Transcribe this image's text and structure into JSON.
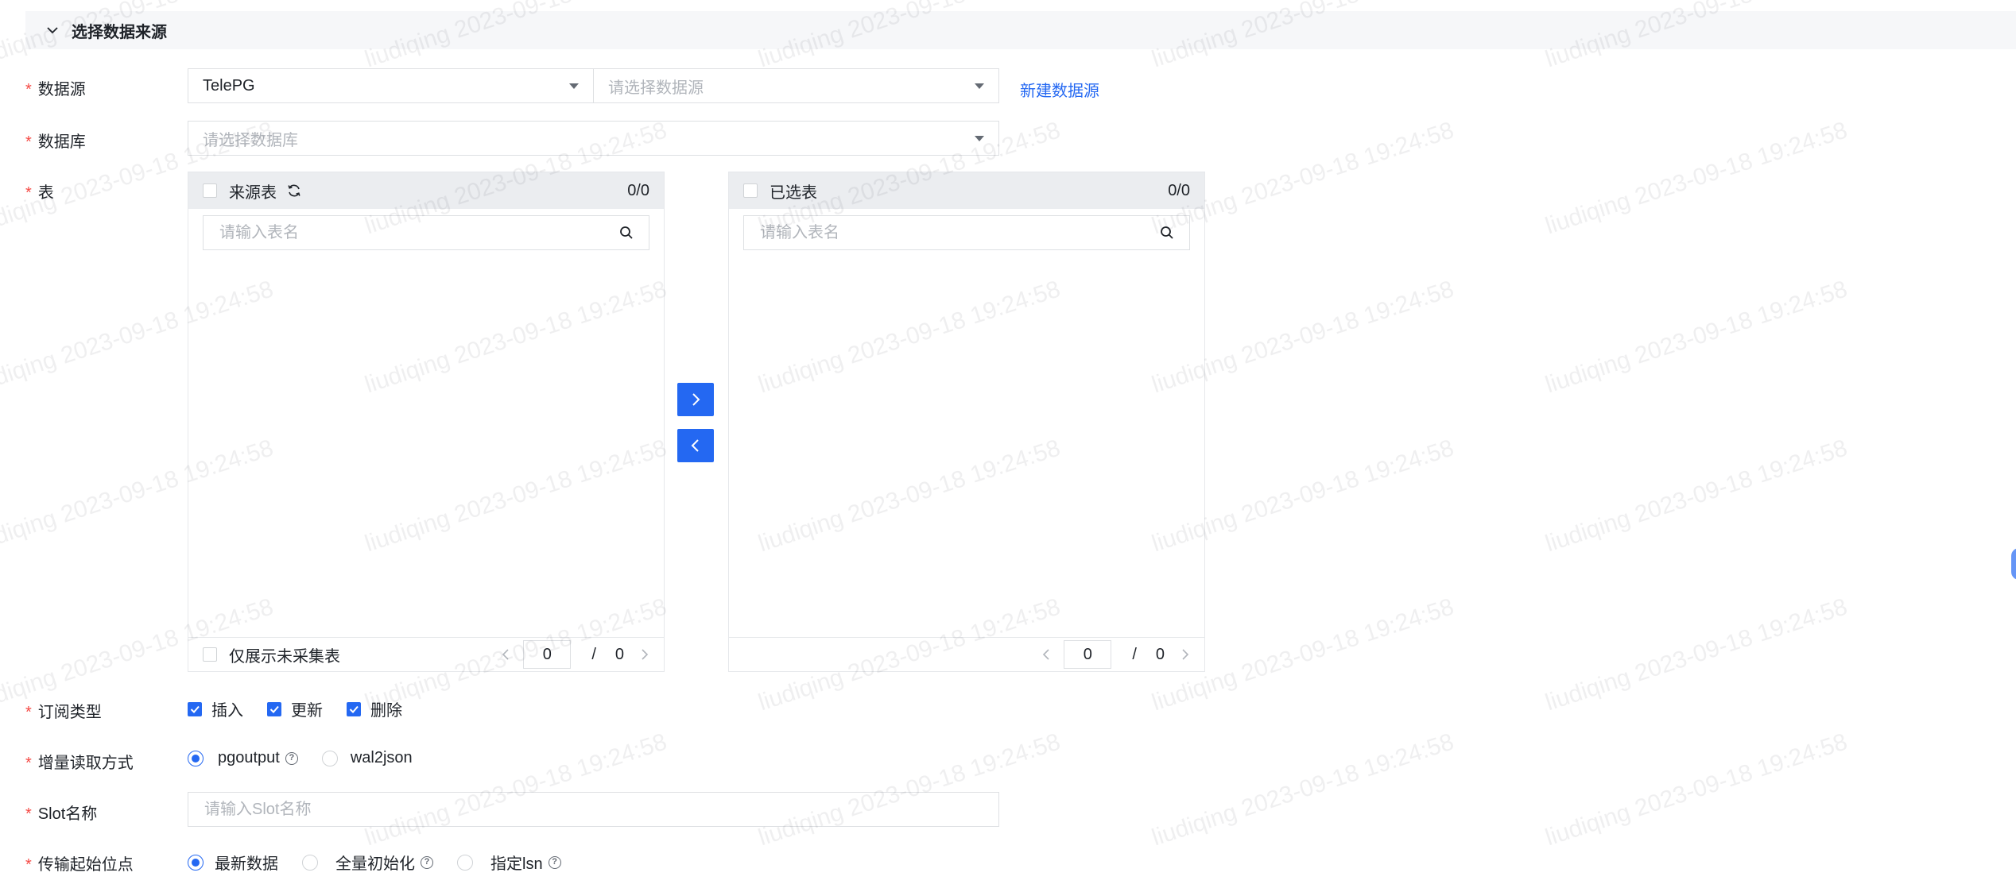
{
  "section": {
    "title": "选择数据来源"
  },
  "datasource": {
    "label": "数据源",
    "type_value": "TelePG",
    "instance_placeholder": "请选择数据源",
    "new_link": "新建数据源"
  },
  "database": {
    "label": "数据库",
    "placeholder": "请选择数据库"
  },
  "table": {
    "label": "表",
    "source": {
      "title": "来源表",
      "count": "0/0",
      "search_placeholder": "请输入表名",
      "only_uncollected": "仅展示未采集表",
      "page": "0",
      "slash": "/",
      "total": "0"
    },
    "target": {
      "title": "已选表",
      "count": "0/0",
      "search_placeholder": "请输入表名",
      "page": "0",
      "slash": "/",
      "total": "0"
    }
  },
  "subscribe": {
    "label": "订阅类型",
    "options": [
      {
        "label": "插入",
        "checked": true
      },
      {
        "label": "更新",
        "checked": true
      },
      {
        "label": "删除",
        "checked": true
      }
    ]
  },
  "incremental": {
    "label": "增量读取方式",
    "options": [
      {
        "label": "pgoutput",
        "selected": true
      },
      {
        "label": "wal2json",
        "selected": false
      }
    ]
  },
  "slot": {
    "label": "Slot名称",
    "placeholder": "请输入Slot名称"
  },
  "start_point": {
    "label": "传输起始位点",
    "options": [
      {
        "label": "最新数据",
        "selected": true
      },
      {
        "label": "全量初始化",
        "selected": false
      },
      {
        "label": "指定lsn",
        "selected": false
      }
    ]
  },
  "watermark": {
    "text": "liudiqing 2023-09-18 19:24:58"
  },
  "colors": {
    "accent": "#2468f2",
    "required": "#f54a45",
    "border": "#dee0e3"
  }
}
